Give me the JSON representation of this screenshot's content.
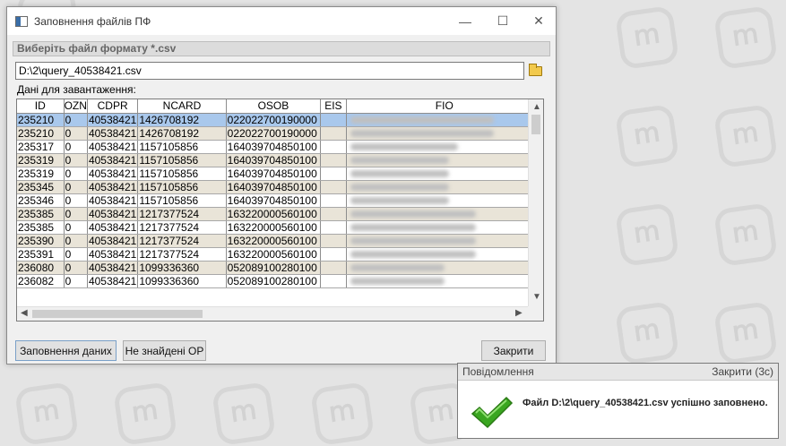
{
  "window": {
    "title": "Заповнення файлів ПФ",
    "minimize": "—",
    "maximize": "☐",
    "close": "✕"
  },
  "group_title": "Виберіть файл формату *.csv",
  "file_path": "D:\\2\\query_40538421.csv",
  "data_label": "Дані для завантаження:",
  "table": {
    "columns": [
      "ID",
      "OZN",
      "CDPR",
      "NCARD",
      "OSOB",
      "EIS",
      "FIO"
    ],
    "rows": [
      [
        "235210",
        "0",
        "40538421",
        "1426708192",
        "022022700190000",
        "",
        ""
      ],
      [
        "235210",
        "0",
        "40538421",
        "1426708192",
        "022022700190000",
        "",
        ""
      ],
      [
        "235317",
        "0",
        "40538421",
        "1157105856",
        "164039704850100",
        "",
        ""
      ],
      [
        "235319",
        "0",
        "40538421",
        "1157105856",
        "164039704850100",
        "",
        ""
      ],
      [
        "235319",
        "0",
        "40538421",
        "1157105856",
        "164039704850100",
        "",
        ""
      ],
      [
        "235345",
        "0",
        "40538421",
        "1157105856",
        "164039704850100",
        "",
        ""
      ],
      [
        "235346",
        "0",
        "40538421",
        "1157105856",
        "164039704850100",
        "",
        ""
      ],
      [
        "235385",
        "0",
        "40538421",
        "1217377524",
        "163220000560100",
        "",
        ""
      ],
      [
        "235385",
        "0",
        "40538421",
        "1217377524",
        "163220000560100",
        "",
        ""
      ],
      [
        "235390",
        "0",
        "40538421",
        "1217377524",
        "163220000560100",
        "",
        ""
      ],
      [
        "235391",
        "0",
        "40538421",
        "1217377524",
        "163220000560100",
        "",
        ""
      ],
      [
        "236080",
        "0",
        "40538421",
        "1099336360",
        "052089100280100",
        "",
        ""
      ],
      [
        "236082",
        "0",
        "40538421",
        "1099336360",
        "052089100280100",
        "",
        ""
      ]
    ]
  },
  "buttons": {
    "fill": "Заповнення даних",
    "not_found": "Не знайдені ОР",
    "close": "Закрити"
  },
  "notification": {
    "title": "Повідомлення",
    "close": "Закрити (3с)",
    "message": "Файл D:\\2\\query_40538421.csv успішно заповнено."
  },
  "colors": {
    "selected_row": "#a9c8ec",
    "alt_row": "#e9e4d8",
    "check": "#3aa620"
  },
  "icons": [
    "app-icon",
    "folder-icon",
    "check-icon"
  ]
}
